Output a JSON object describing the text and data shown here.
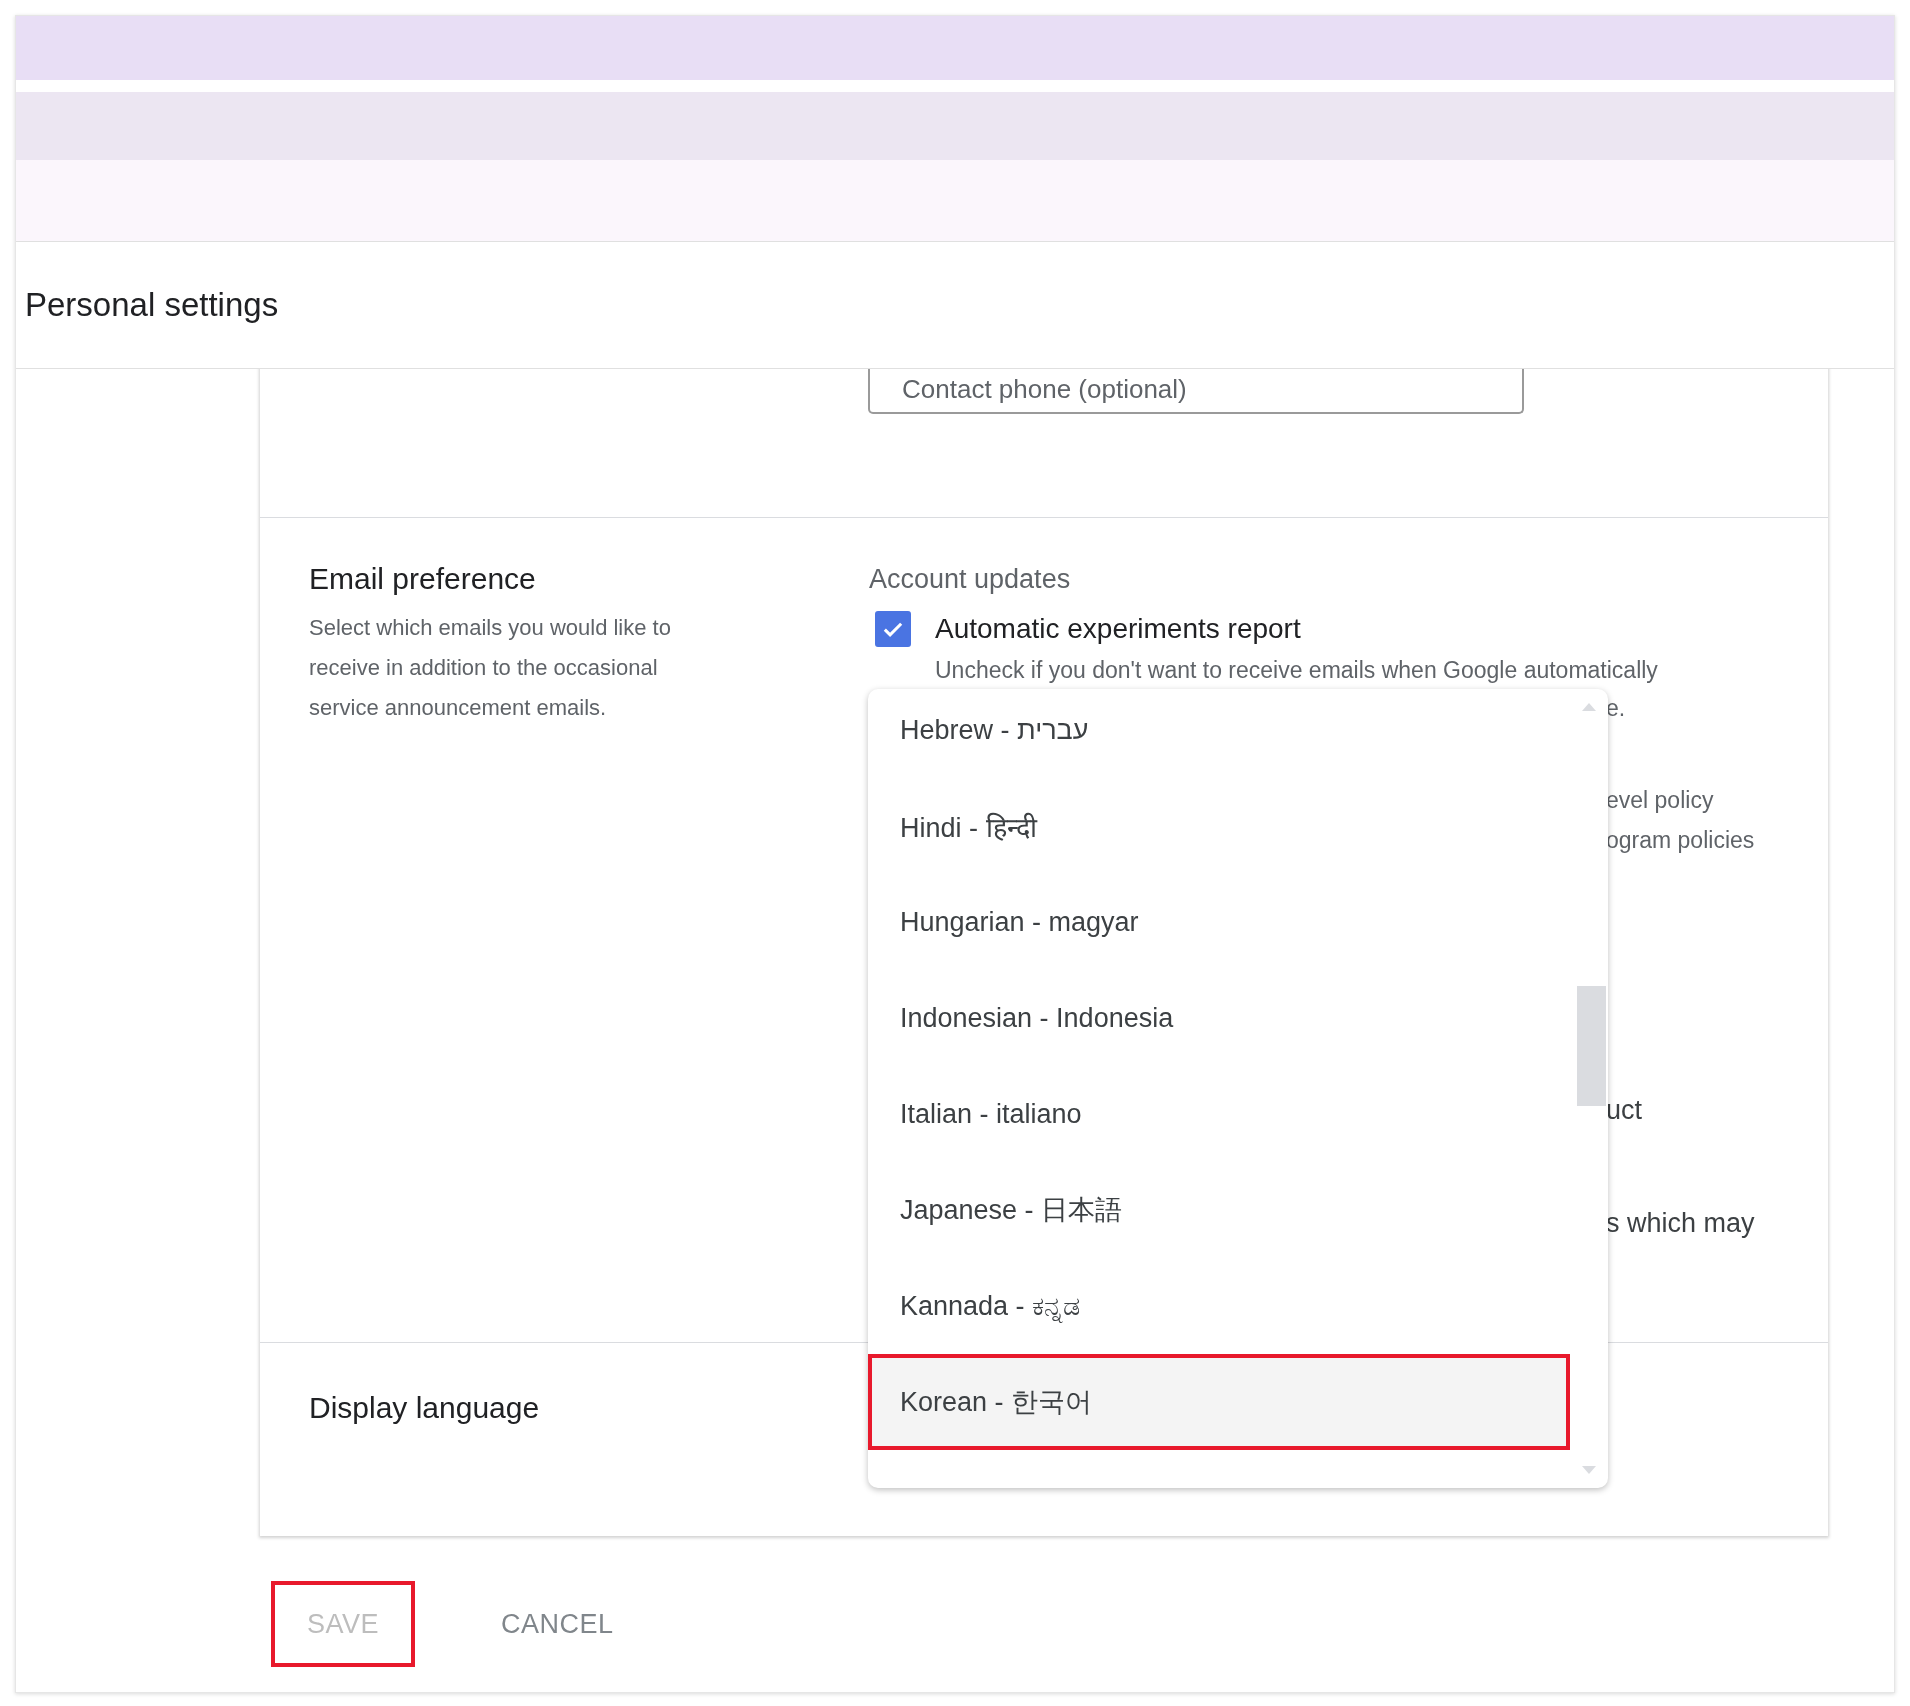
{
  "header": {
    "title": "Personal settings"
  },
  "contact_phone": {
    "label": "Contact phone (optional)"
  },
  "email_preference": {
    "title": "Email preference",
    "description": "Select which emails you would like to receive in addition to the occasional service announcement emails.",
    "group_title": "Account updates",
    "options": [
      {
        "label": "Automatic experiments report",
        "checked": true,
        "description": "Uncheck if you don't want to receive emails when Google automatically"
      }
    ]
  },
  "partly_hidden_texts": [
    {
      "text": "e.",
      "kind": "small"
    },
    {
      "text": "evel policy",
      "kind": "small"
    },
    {
      "text": "ogram policies",
      "kind": "small"
    },
    {
      "text": "uct",
      "kind": "large"
    },
    {
      "text": "s which may",
      "kind": "large"
    }
  ],
  "display_language": {
    "label": "Display language"
  },
  "language_menu": {
    "items": [
      {
        "label": "Hebrew - עברית",
        "selected": false
      },
      {
        "label": "Hindi - हिन्दी",
        "selected": false
      },
      {
        "label": "Hungarian - magyar",
        "selected": false
      },
      {
        "label": "Indonesian - Indonesia",
        "selected": false
      },
      {
        "label": "Italian - italiano",
        "selected": false
      },
      {
        "label": "Japanese - 日本語",
        "selected": false
      },
      {
        "label": "Kannada - ಕನ್ನಡ",
        "selected": false
      },
      {
        "label": "Korean - 한국어",
        "selected": true
      }
    ]
  },
  "buttons": [
    {
      "label": "SAVE",
      "disabled": true,
      "highlighted": true
    },
    {
      "label": "CANCEL",
      "disabled": false,
      "highlighted": false
    }
  ]
}
